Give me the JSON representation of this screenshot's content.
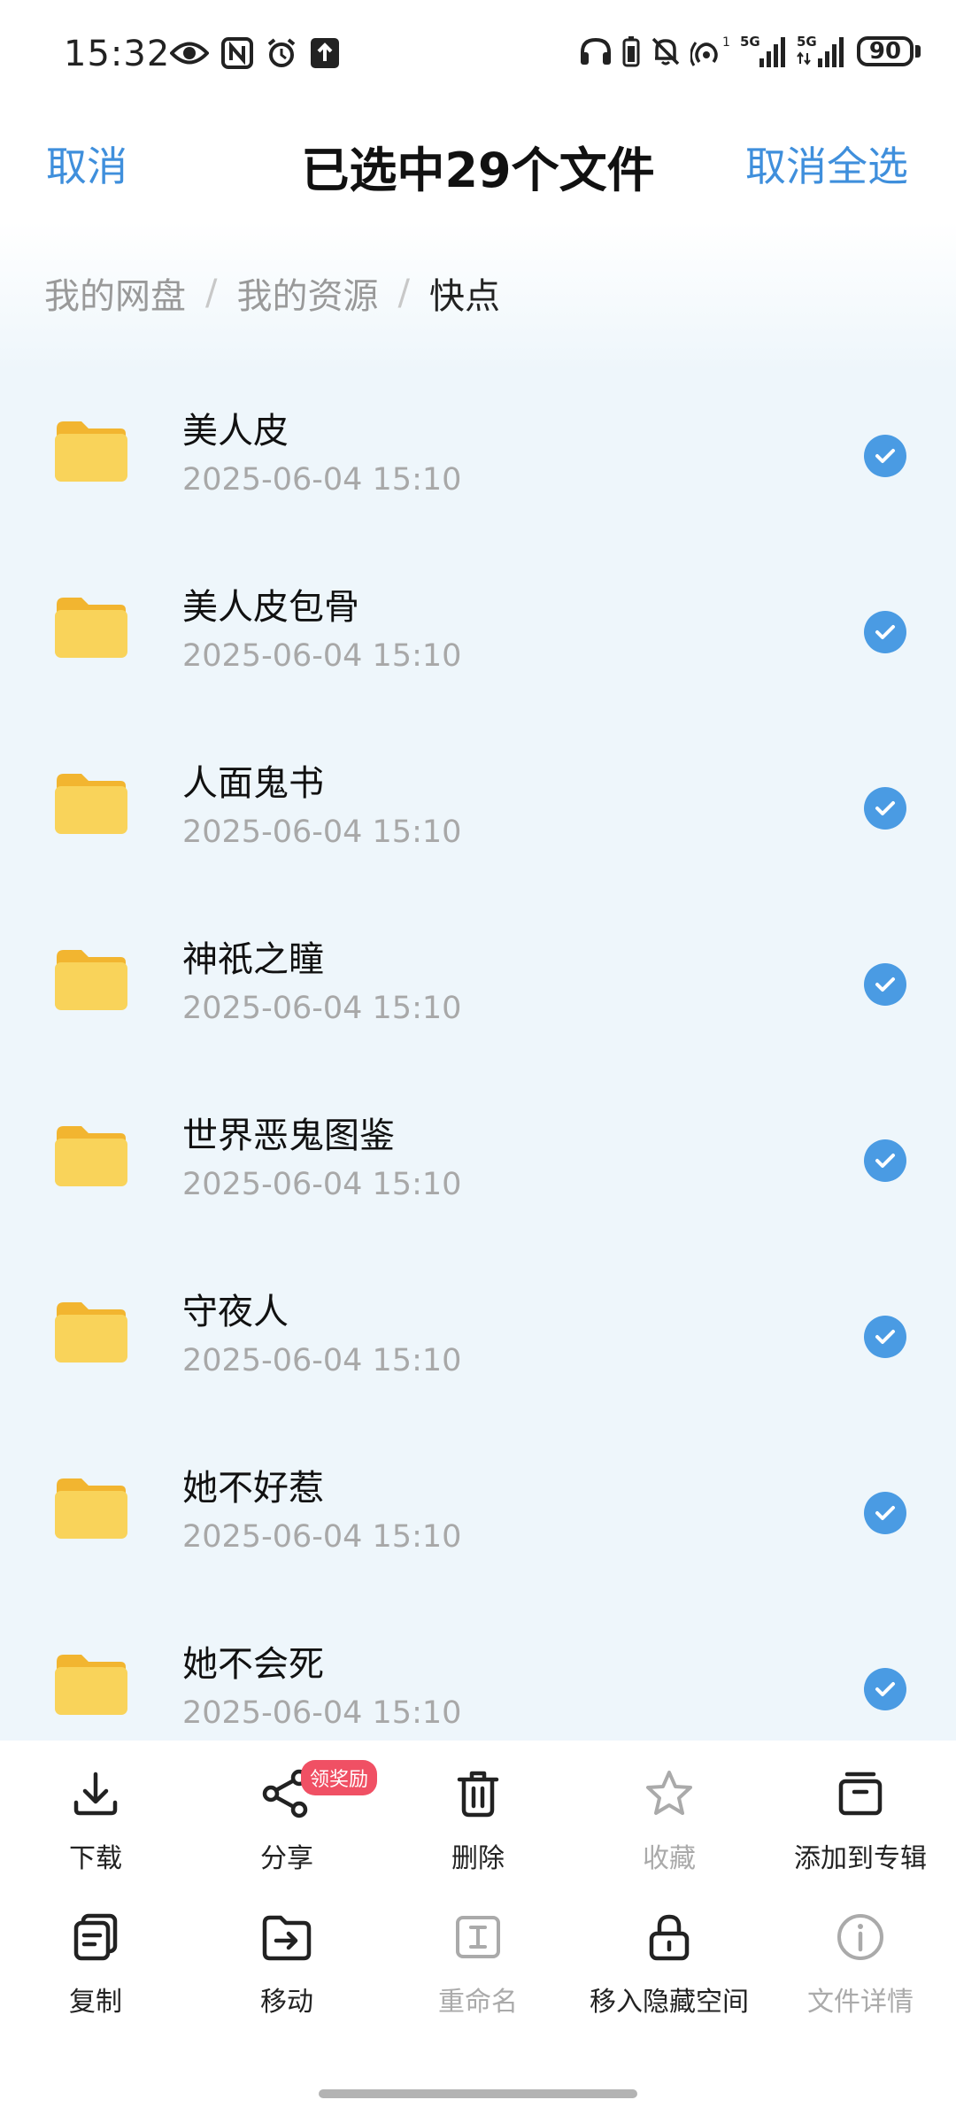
{
  "status_bar": {
    "time": "15:32",
    "left_icons": [
      "eye-icon",
      "nfc-icon",
      "alarm-icon",
      "upload-icon"
    ],
    "right_icons": [
      "headphones-icon",
      "battery-saver-icon",
      "mute-icon",
      "hotspot-icon",
      "signal-5g-icon",
      "signal-5g-icon"
    ],
    "battery": "90",
    "signal_sim1": "5G",
    "signal_sim2": "5G",
    "hotspot_badge": "1"
  },
  "header": {
    "cancel": "取消",
    "title": "已选中29个文件",
    "deselect_all": "取消全选"
  },
  "breadcrumb": {
    "items": [
      "我的网盘",
      "我的资源",
      "快点"
    ],
    "separator": "/"
  },
  "files": [
    {
      "name": "美人皮",
      "date": "2025-06-04  15:10",
      "selected": true
    },
    {
      "name": "美人皮包骨",
      "date": "2025-06-04  15:10",
      "selected": true
    },
    {
      "name": "人面鬼书",
      "date": "2025-06-04  15:10",
      "selected": true
    },
    {
      "name": "神祇之瞳",
      "date": "2025-06-04  15:10",
      "selected": true
    },
    {
      "name": "世界恶鬼图鉴",
      "date": "2025-06-04  15:10",
      "selected": true
    },
    {
      "name": "守夜人",
      "date": "2025-06-04  15:10",
      "selected": true
    },
    {
      "name": "她不好惹",
      "date": "2025-06-04  15:10",
      "selected": true
    },
    {
      "name": "她不会死",
      "date": "2025-06-04  15:10",
      "selected": true
    }
  ],
  "actions": {
    "download": "下载",
    "share": "分享",
    "share_badge": "领奖励",
    "delete": "删除",
    "favorite": "收藏",
    "add_to_album": "添加到专辑",
    "copy": "复制",
    "move": "移动",
    "rename": "重命名",
    "hide": "移入隐藏空间",
    "details": "文件详情"
  },
  "colors": {
    "accent": "#3f8fdc",
    "check": "#4a9be3",
    "folder": "#f7c948",
    "badge": "#f05064"
  }
}
